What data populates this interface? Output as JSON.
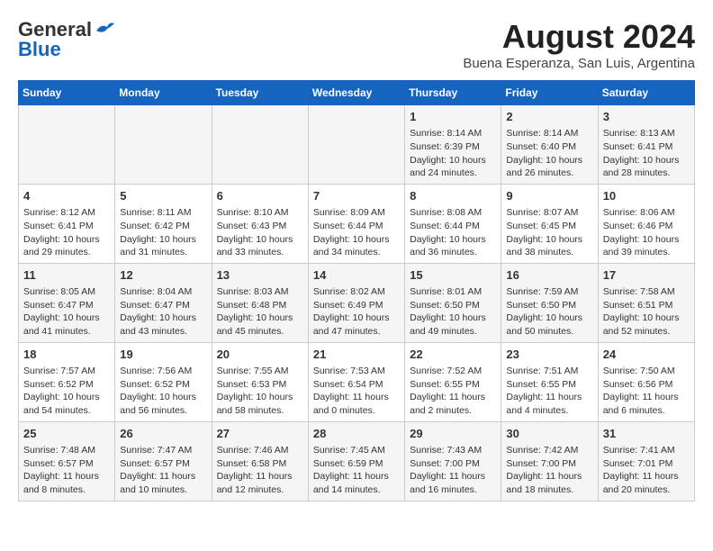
{
  "header": {
    "logo_general": "General",
    "logo_blue": "Blue",
    "month_year": "August 2024",
    "location": "Buena Esperanza, San Luis, Argentina"
  },
  "days_of_week": [
    "Sunday",
    "Monday",
    "Tuesday",
    "Wednesday",
    "Thursday",
    "Friday",
    "Saturday"
  ],
  "weeks": [
    [
      {
        "day": "",
        "content": ""
      },
      {
        "day": "",
        "content": ""
      },
      {
        "day": "",
        "content": ""
      },
      {
        "day": "",
        "content": ""
      },
      {
        "day": "1",
        "content": "Sunrise: 8:14 AM\nSunset: 6:39 PM\nDaylight: 10 hours\nand 24 minutes."
      },
      {
        "day": "2",
        "content": "Sunrise: 8:14 AM\nSunset: 6:40 PM\nDaylight: 10 hours\nand 26 minutes."
      },
      {
        "day": "3",
        "content": "Sunrise: 8:13 AM\nSunset: 6:41 PM\nDaylight: 10 hours\nand 28 minutes."
      }
    ],
    [
      {
        "day": "4",
        "content": "Sunrise: 8:12 AM\nSunset: 6:41 PM\nDaylight: 10 hours\nand 29 minutes."
      },
      {
        "day": "5",
        "content": "Sunrise: 8:11 AM\nSunset: 6:42 PM\nDaylight: 10 hours\nand 31 minutes."
      },
      {
        "day": "6",
        "content": "Sunrise: 8:10 AM\nSunset: 6:43 PM\nDaylight: 10 hours\nand 33 minutes."
      },
      {
        "day": "7",
        "content": "Sunrise: 8:09 AM\nSunset: 6:44 PM\nDaylight: 10 hours\nand 34 minutes."
      },
      {
        "day": "8",
        "content": "Sunrise: 8:08 AM\nSunset: 6:44 PM\nDaylight: 10 hours\nand 36 minutes."
      },
      {
        "day": "9",
        "content": "Sunrise: 8:07 AM\nSunset: 6:45 PM\nDaylight: 10 hours\nand 38 minutes."
      },
      {
        "day": "10",
        "content": "Sunrise: 8:06 AM\nSunset: 6:46 PM\nDaylight: 10 hours\nand 39 minutes."
      }
    ],
    [
      {
        "day": "11",
        "content": "Sunrise: 8:05 AM\nSunset: 6:47 PM\nDaylight: 10 hours\nand 41 minutes."
      },
      {
        "day": "12",
        "content": "Sunrise: 8:04 AM\nSunset: 6:47 PM\nDaylight: 10 hours\nand 43 minutes."
      },
      {
        "day": "13",
        "content": "Sunrise: 8:03 AM\nSunset: 6:48 PM\nDaylight: 10 hours\nand 45 minutes."
      },
      {
        "day": "14",
        "content": "Sunrise: 8:02 AM\nSunset: 6:49 PM\nDaylight: 10 hours\nand 47 minutes."
      },
      {
        "day": "15",
        "content": "Sunrise: 8:01 AM\nSunset: 6:50 PM\nDaylight: 10 hours\nand 49 minutes."
      },
      {
        "day": "16",
        "content": "Sunrise: 7:59 AM\nSunset: 6:50 PM\nDaylight: 10 hours\nand 50 minutes."
      },
      {
        "day": "17",
        "content": "Sunrise: 7:58 AM\nSunset: 6:51 PM\nDaylight: 10 hours\nand 52 minutes."
      }
    ],
    [
      {
        "day": "18",
        "content": "Sunrise: 7:57 AM\nSunset: 6:52 PM\nDaylight: 10 hours\nand 54 minutes."
      },
      {
        "day": "19",
        "content": "Sunrise: 7:56 AM\nSunset: 6:52 PM\nDaylight: 10 hours\nand 56 minutes."
      },
      {
        "day": "20",
        "content": "Sunrise: 7:55 AM\nSunset: 6:53 PM\nDaylight: 10 hours\nand 58 minutes."
      },
      {
        "day": "21",
        "content": "Sunrise: 7:53 AM\nSunset: 6:54 PM\nDaylight: 11 hours\nand 0 minutes."
      },
      {
        "day": "22",
        "content": "Sunrise: 7:52 AM\nSunset: 6:55 PM\nDaylight: 11 hours\nand 2 minutes."
      },
      {
        "day": "23",
        "content": "Sunrise: 7:51 AM\nSunset: 6:55 PM\nDaylight: 11 hours\nand 4 minutes."
      },
      {
        "day": "24",
        "content": "Sunrise: 7:50 AM\nSunset: 6:56 PM\nDaylight: 11 hours\nand 6 minutes."
      }
    ],
    [
      {
        "day": "25",
        "content": "Sunrise: 7:48 AM\nSunset: 6:57 PM\nDaylight: 11 hours\nand 8 minutes."
      },
      {
        "day": "26",
        "content": "Sunrise: 7:47 AM\nSunset: 6:57 PM\nDaylight: 11 hours\nand 10 minutes."
      },
      {
        "day": "27",
        "content": "Sunrise: 7:46 AM\nSunset: 6:58 PM\nDaylight: 11 hours\nand 12 minutes."
      },
      {
        "day": "28",
        "content": "Sunrise: 7:45 AM\nSunset: 6:59 PM\nDaylight: 11 hours\nand 14 minutes."
      },
      {
        "day": "29",
        "content": "Sunrise: 7:43 AM\nSunset: 7:00 PM\nDaylight: 11 hours\nand 16 minutes."
      },
      {
        "day": "30",
        "content": "Sunrise: 7:42 AM\nSunset: 7:00 PM\nDaylight: 11 hours\nand 18 minutes."
      },
      {
        "day": "31",
        "content": "Sunrise: 7:41 AM\nSunset: 7:01 PM\nDaylight: 11 hours\nand 20 minutes."
      }
    ]
  ]
}
